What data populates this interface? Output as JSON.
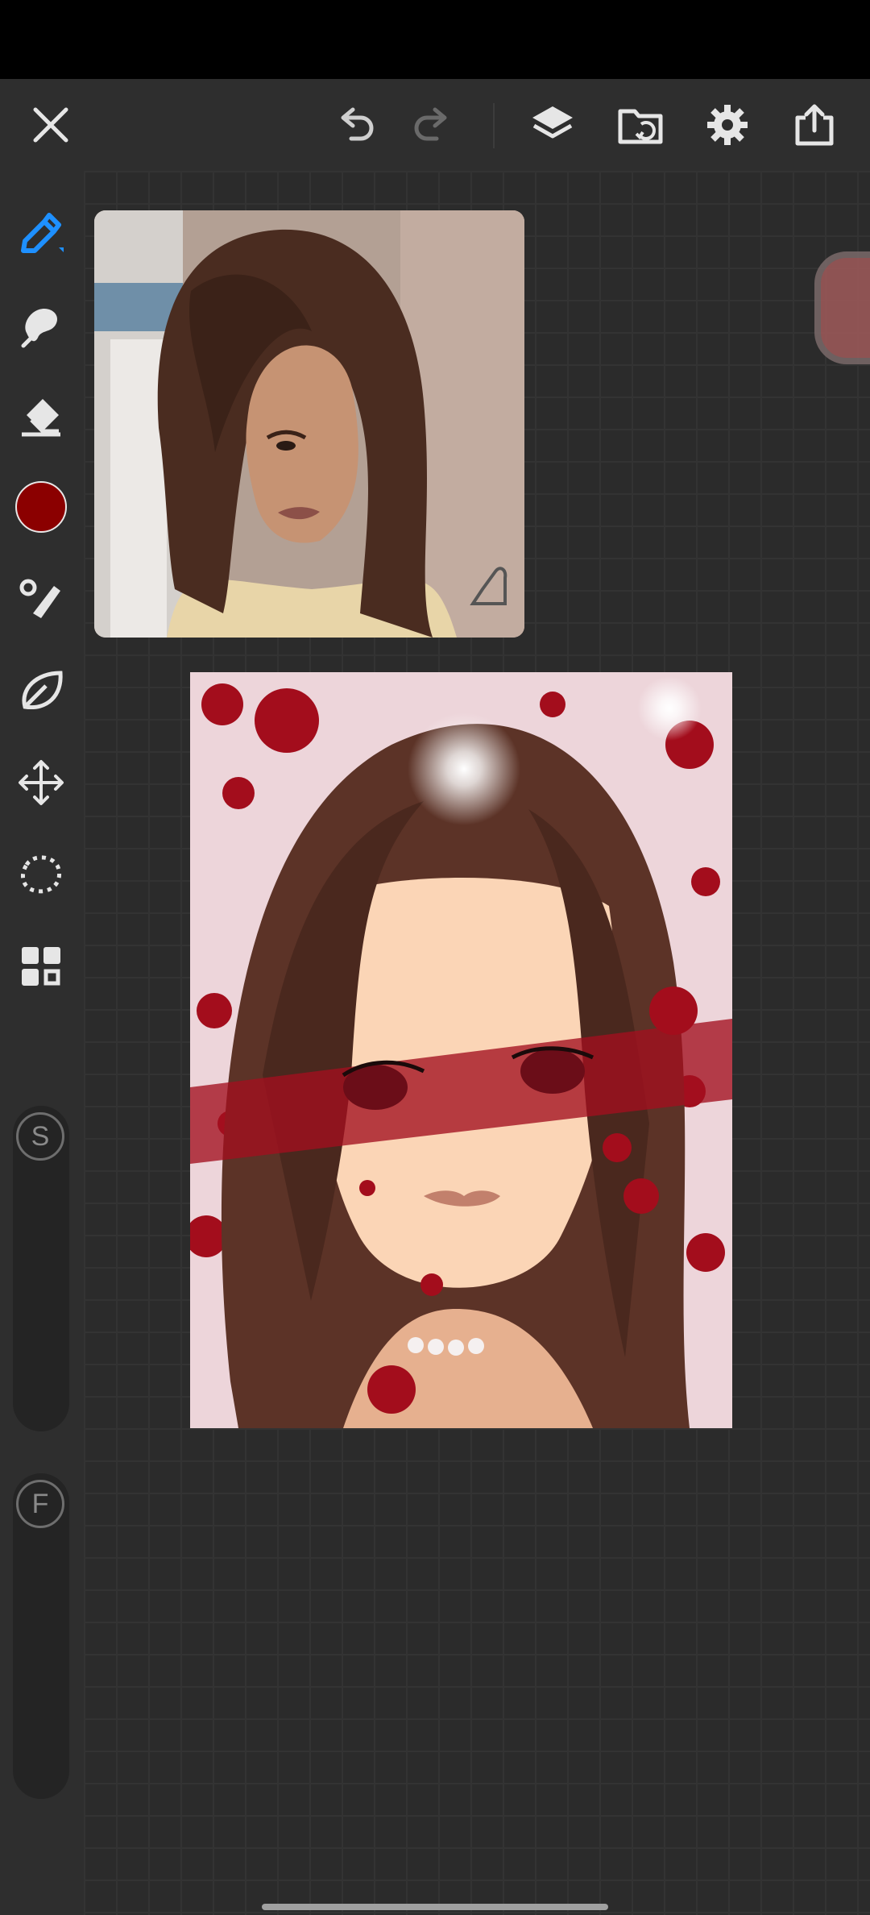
{
  "app": {
    "accent_color": "#1e90ff",
    "current_color": "#8b0000"
  },
  "toolbar": {
    "icons": [
      "close-icon",
      "undo-icon",
      "redo-icon",
      "layers-icon",
      "import-icon",
      "settings-icon",
      "share-icon"
    ]
  },
  "sidebar": {
    "tools": [
      "brush-icon",
      "smudge-icon",
      "eraser-icon",
      "color-icon",
      "mixer-icon",
      "liquify-icon",
      "transform-icon",
      "selection-icon",
      "gallery-icon"
    ],
    "size_slider": {
      "label": "S"
    },
    "opacity_slider": {
      "label": "F"
    }
  },
  "canvas": {
    "reference_window": {
      "content": "reference-image"
    },
    "artwork": {
      "content": "painting"
    }
  }
}
